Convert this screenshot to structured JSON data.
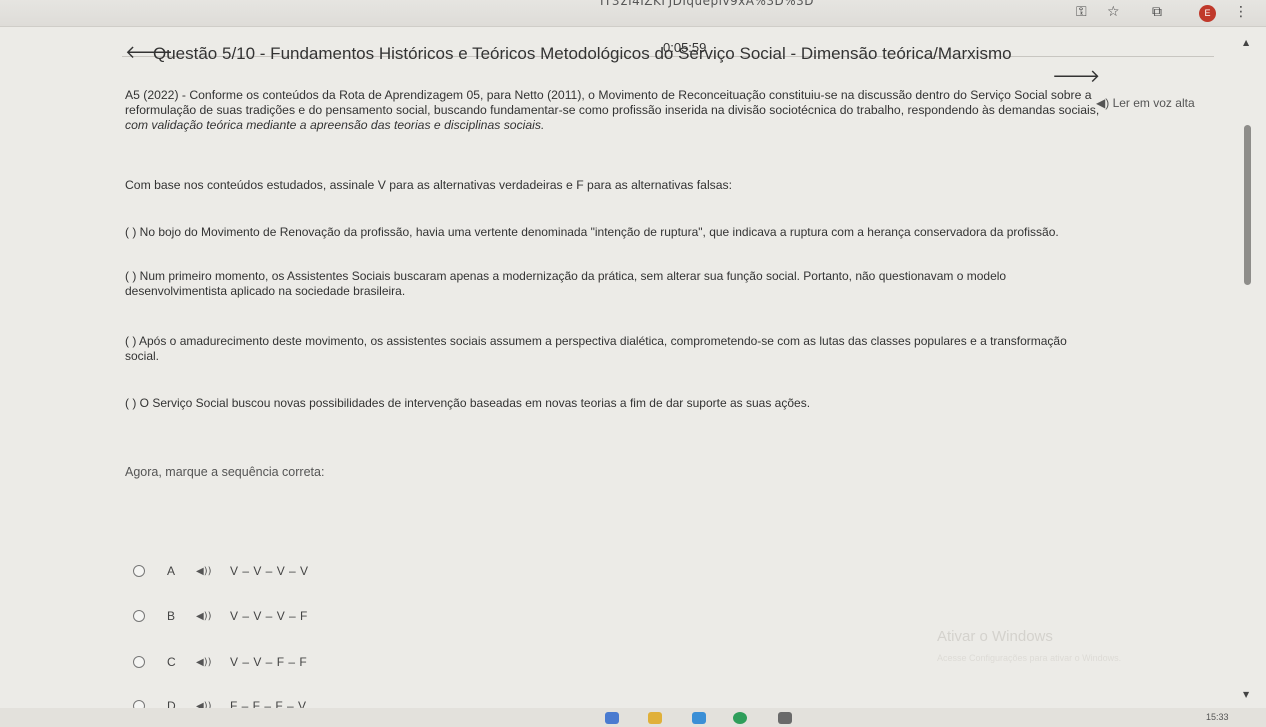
{
  "browser": {
    "url_fragment": "ΙΤ3ΣΙ4ΙΖΚΓJDIqueplv9xA%3D%3D",
    "profile_initial": "E",
    "icons": [
      "key-icon",
      "star-icon",
      "extension-icon",
      "menu-icon"
    ]
  },
  "quiz": {
    "timer": "0:05:59",
    "title": "Questão 5/10 - Fundamentos Históricos e Teóricos Metodológicos do Serviço Social - Dimensão teórica/Marxismo",
    "read_aloud": "Ler em voz alta",
    "intro_lines": [
      "A5 (2022) - Conforme os conteúdos da Rota de Aprendizagem 05, para Netto (2011), o Movimento de Reconceituação constituiu-se na discussão dentro do Serviço Social sobre a",
      "reformulação de suas tradições e do pensamento social, buscando fundamentar-se como profissão inserida na divisão sociotécnica do trabalho, respondendo às demandas sociais,",
      "com validação teórica mediante a apreensão das teorias e disciplinas sociais."
    ],
    "instruction": "Com base nos conteúdos estudados, assinale V para as alternativas verdadeiras e F para as alternativas falsas:",
    "statements": [
      {
        "l1": "(  ) No bojo do Movimento de Renovação da profissão, havia uma vertente denominada \"intenção de ruptura\", que indicava a ruptura com a herança conservadora da profissão.",
        "l2": ""
      },
      {
        "l1": "(  ) Num primeiro momento, os Assistentes Sociais buscaram apenas a modernização da prática, sem alterar sua função social. Portanto, não questionavam o modelo",
        "l2": "desenvolvimentista aplicado na sociedade brasileira."
      },
      {
        "l1": "(  ) Após o amadurecimento deste movimento, os assistentes sociais assumem a perspectiva dialética, comprometendo-se com as lutas das classes populares e a transformação",
        "l2": "social."
      },
      {
        "l1": "(  ) O Serviço Social buscou novas possibilidades de intervenção baseadas em novas teorias a fim de dar suporte as suas ações.",
        "l2": ""
      }
    ],
    "prompt": "Agora, marque a sequência correta:",
    "options": [
      {
        "letter": "A",
        "answer": "V – V – V – V"
      },
      {
        "letter": "B",
        "answer": "V – V – V – F"
      },
      {
        "letter": "C",
        "answer": "V – V – F – F"
      },
      {
        "letter": "D",
        "answer": "F – F – F – V"
      }
    ]
  },
  "watermark": {
    "line1": "Ativar o Windows",
    "line2": "Acesse Configurações para ativar o Windows."
  },
  "taskbar": {
    "clock": "15:33"
  }
}
